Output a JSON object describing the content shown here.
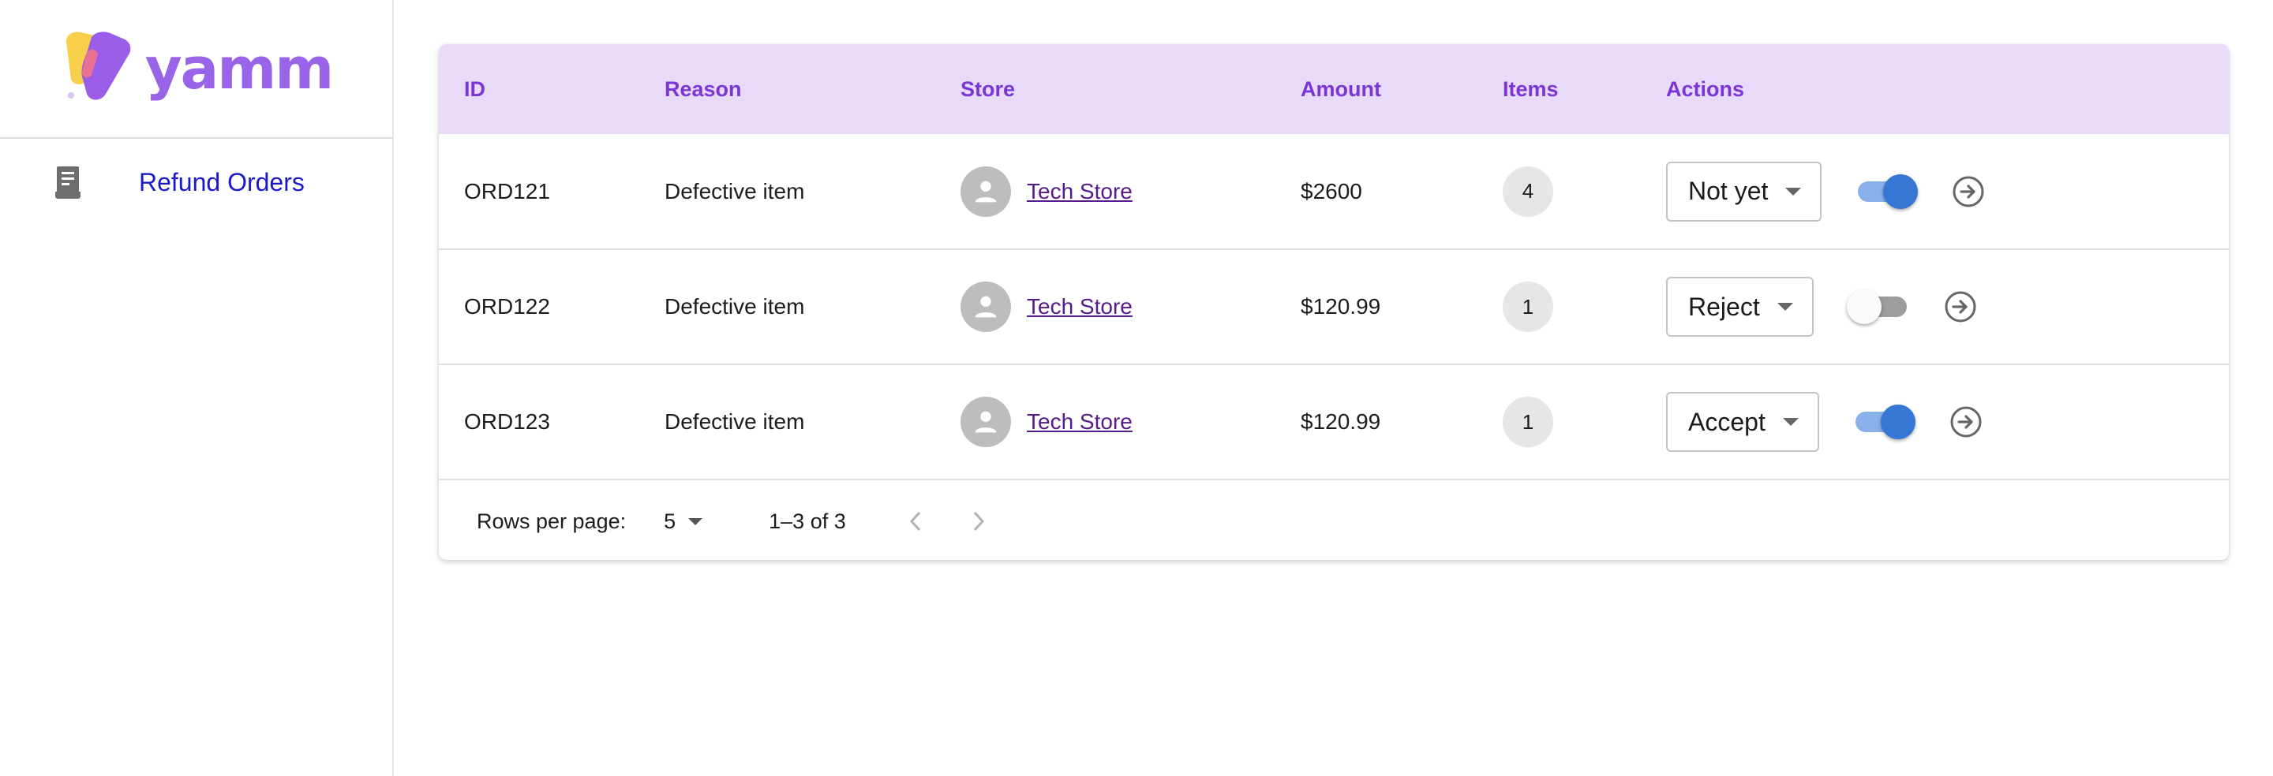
{
  "brand": {
    "name": "yamm"
  },
  "sidebar": {
    "items": [
      {
        "label": "Refund Orders",
        "icon": "receipt-icon"
      }
    ]
  },
  "table": {
    "columns": [
      "ID",
      "Reason",
      "Store",
      "Amount",
      "Items",
      "Actions"
    ],
    "rows": [
      {
        "id": "ORD121",
        "reason": "Defective item",
        "store": "Tech Store",
        "amount": "$2600",
        "items": "4",
        "decision": "Not yet",
        "active": true
      },
      {
        "id": "ORD122",
        "reason": "Defective item",
        "store": "Tech Store",
        "amount": "$120.99",
        "items": "1",
        "decision": "Reject",
        "active": false
      },
      {
        "id": "ORD123",
        "reason": "Defective item",
        "store": "Tech Store",
        "amount": "$120.99",
        "items": "1",
        "decision": "Accept",
        "active": true
      }
    ]
  },
  "pagination": {
    "rows_per_page_label": "Rows per page:",
    "rows_per_page_value": "5",
    "range_text": "1–3 of 3"
  },
  "colors": {
    "accent": "#7b35d6",
    "header_bg": "#e8daf9",
    "switch_on": "#3676d4",
    "link": "#551a8b",
    "nav_link": "#1a1ac8"
  }
}
